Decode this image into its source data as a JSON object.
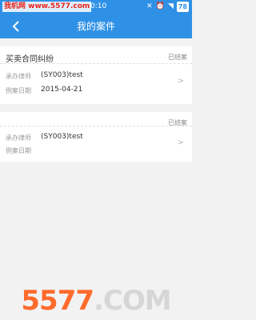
{
  "status_bar": {
    "watermark": "我机网 www.5577.com",
    "time": "0:10",
    "battery": "78"
  },
  "header": {
    "title": "我的案件"
  },
  "cases": [
    {
      "title": "买卖合同纠纷",
      "status": "已结案",
      "lawyer_label": "承办律师",
      "lawyer": "(SY003)test",
      "date_label": "例案日期",
      "date": "2015-04-21"
    },
    {
      "title": "",
      "status": "已结案",
      "lawyer_label": "承办律师",
      "lawyer": "(SY003)test",
      "date_label": "例案日期",
      "date": ""
    }
  ],
  "promo": {
    "number": "5577",
    "domain": ".COM"
  },
  "colors": {
    "primary": "#2f91e6",
    "background": "#f2f2f2"
  }
}
